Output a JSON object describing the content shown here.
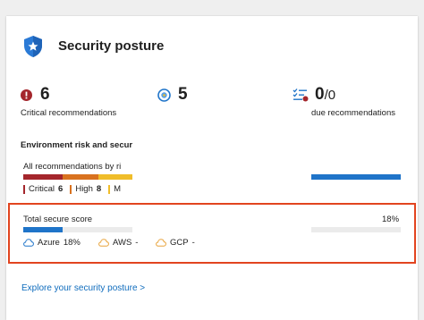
{
  "card": {
    "title": "Security posture",
    "shield_icon": "shield-star-icon"
  },
  "metrics": [
    {
      "icon": "critical-alert-icon",
      "value": "6",
      "label": "Critical recommendations"
    },
    {
      "icon": "target-icon",
      "value": "5",
      "label": ""
    },
    {
      "icon": "checklist-icon",
      "value": "0",
      "value_suffix": "/0",
      "label": "due recommendations"
    }
  ],
  "environment": {
    "heading": "Environment risk and secure",
    "all_recs_label": "All recommendations by ri",
    "severity_bar": [
      {
        "name": "Critical",
        "fraction": 0.36,
        "color": "#a4262c"
      },
      {
        "name": "High",
        "fraction": 0.33,
        "color": "#d9721f"
      },
      {
        "name": "Medium",
        "fraction": 0.31,
        "color": "#f0bd2a"
      }
    ],
    "right_bar_color": "#1f74c9",
    "legend": [
      {
        "label": "Critical",
        "count": "6",
        "color": "#a4262c"
      },
      {
        "label": "High",
        "count": "8",
        "color": "#d9721f"
      },
      {
        "label": "M",
        "count": "",
        "color": "#f0bd2a"
      }
    ]
  },
  "secure_score": {
    "label": "Total secure score",
    "percent_text": "18%",
    "fraction": 0.18,
    "bar_color": "#1f74c9",
    "clouds": [
      {
        "icon": "azure-cloud-icon",
        "name": "Azure",
        "value": "18%",
        "color": "#1f74c9"
      },
      {
        "icon": "aws-cloud-icon",
        "name": "AWS",
        "value": "-",
        "color": "#e8a33b"
      },
      {
        "icon": "gcp-cloud-icon",
        "name": "GCP",
        "value": "-",
        "color": "#e8a33b"
      }
    ]
  },
  "footer": {
    "link_label": "Explore your security posture >"
  }
}
